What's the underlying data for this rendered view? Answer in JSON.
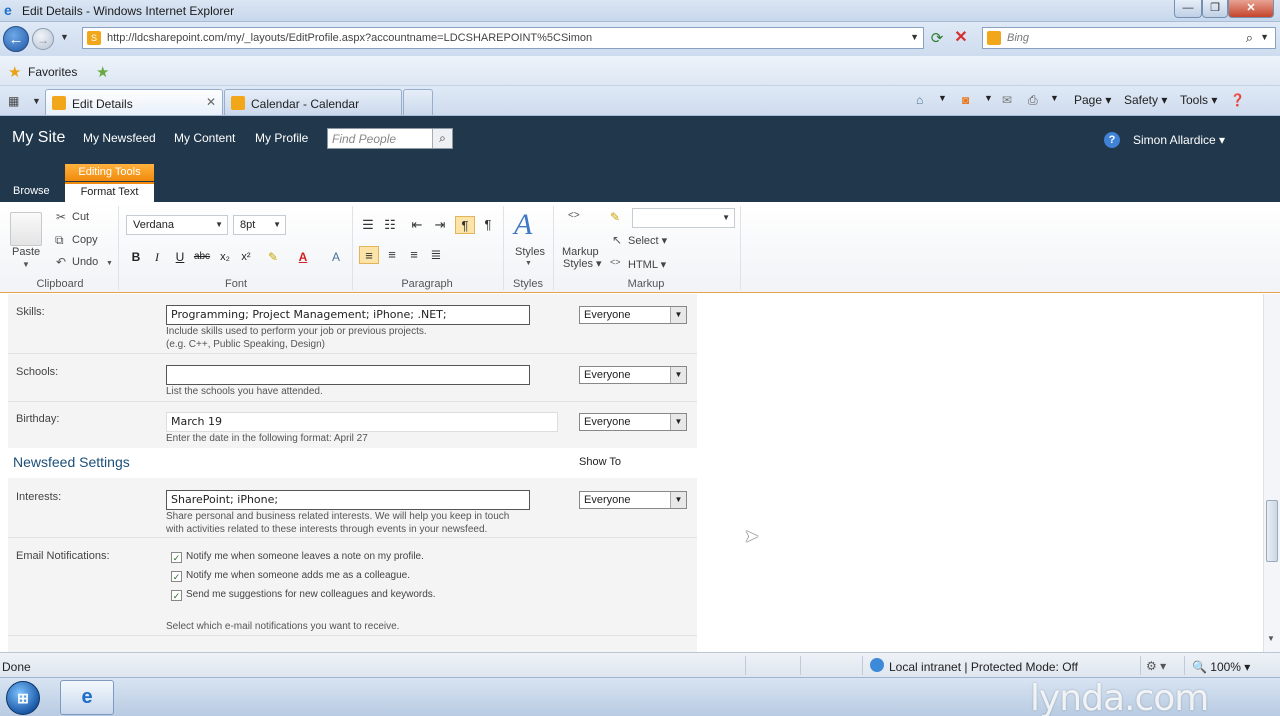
{
  "browser": {
    "window_title": "Edit Details - Windows Internet Explorer",
    "window_buttons": {
      "minimize": "—",
      "maximize": "❐",
      "close": "✕"
    },
    "address_url": "http://ldcsharepoint.com/my/_layouts/EditProfile.aspx?accountname=LDCSHAREPOINT%5CSimon",
    "search_placeholder": "Bing",
    "favorites_label": "Favorites",
    "tabs": [
      {
        "label": "Edit Details",
        "active": true
      },
      {
        "label": "Calendar - Calendar",
        "active": false
      }
    ],
    "commands": {
      "page": "Page ▾",
      "safety": "Safety ▾",
      "tools": "Tools ▾"
    }
  },
  "sharepoint": {
    "site_title": "My Site",
    "nav": [
      "My Newsfeed",
      "My Content",
      "My Profile"
    ],
    "search_placeholder": "Find People",
    "user_name": "Simon Allardice ▾"
  },
  "ribbon": {
    "context_label": "Editing Tools",
    "tabs": {
      "browse": "Browse",
      "format_text": "Format Text"
    },
    "clipboard": {
      "paste": "Paste",
      "cut": "Cut",
      "copy": "Copy",
      "undo": "Undo",
      "group": "Clipboard"
    },
    "font": {
      "face": "Verdana",
      "size": "8pt",
      "group": "Font"
    },
    "paragraph": {
      "group": "Paragraph"
    },
    "styles": {
      "label": "Styles",
      "group": "Styles"
    },
    "markup": {
      "markup_styles_1": "Markup",
      "markup_styles_2": "Styles ▾",
      "select": "Select ▾",
      "html": "HTML ▾",
      "group": "Markup"
    }
  },
  "form": {
    "privacy_option": "Everyone",
    "skills": {
      "label": "Skills:",
      "value": "Programming; Project Management; iPhone; .NET;",
      "hint_1": "Include skills used to perform your job or previous projects.",
      "hint_2": "(e.g. C++, Public Speaking, Design)"
    },
    "schools": {
      "label": "Schools:",
      "value": "",
      "hint": "List the schools you have attended."
    },
    "birthday": {
      "label": "Birthday:",
      "value": "March 19",
      "hint": "Enter the date in the following format: April 27"
    },
    "newsfeed_settings": {
      "heading": "Newsfeed Settings",
      "show_to": "Show To"
    },
    "interests": {
      "label": "Interests:",
      "value": "SharePoint; iPhone;",
      "hint_1": "Share personal and business related interests. We will help you keep in touch",
      "hint_2": "with activities related to these interests through events in your newsfeed."
    },
    "email_notifications": {
      "label": "Email Notifications:",
      "options": [
        "Notify me when someone leaves a note on my profile.",
        "Notify me when someone adds me as a colleague.",
        "Send me suggestions for new colleagues and keywords."
      ],
      "hint": "Select which e-mail notifications you want to receive."
    }
  },
  "status": {
    "left": "Done",
    "zone": "Local intranet | Protected Mode: Off",
    "zoom": "🔍 100%  ▾"
  },
  "watermark": "lynda.com"
}
